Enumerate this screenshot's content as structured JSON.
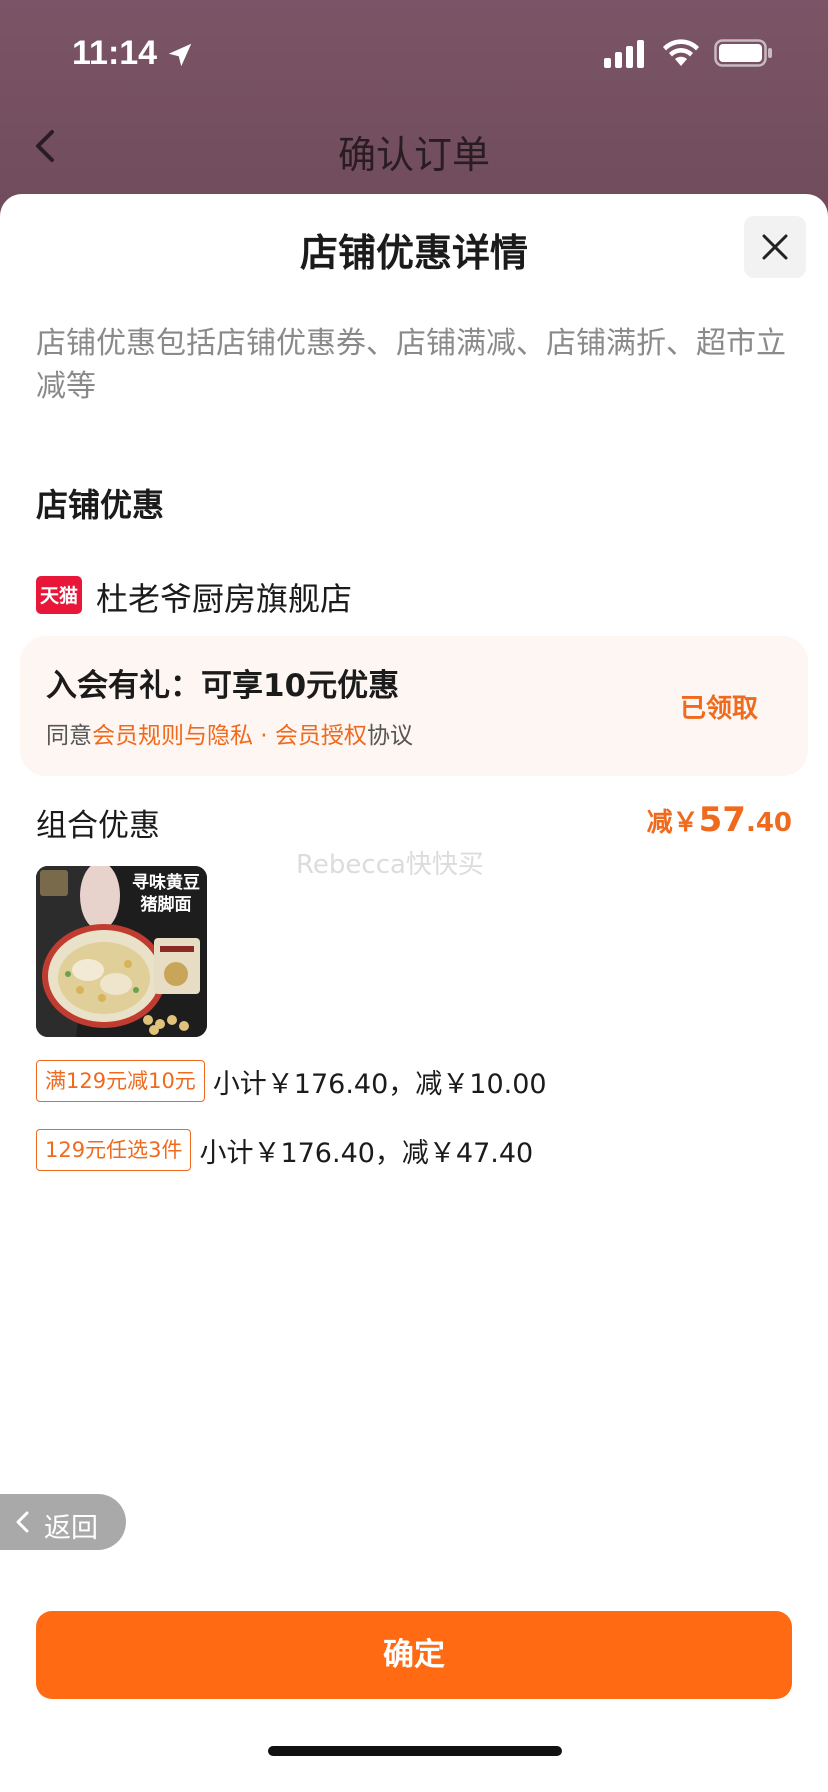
{
  "status_bar": {
    "time": "11:14"
  },
  "order_header": {
    "title": "确认订单"
  },
  "sheet": {
    "title": "店铺优惠详情",
    "description": "店铺优惠包括店铺优惠券、店铺满减、店铺满折、超市立减等",
    "section_title": "店铺优惠",
    "store": {
      "logo_text": "天猫",
      "name": "杜老爷厨房旗舰店"
    },
    "member_offer": {
      "title": "入会有礼：可享10元优惠",
      "agree_prefix": "同意",
      "agree_link": "会员规则与隐私 · 会员授权",
      "agree_suffix": "协议",
      "status": "已领取"
    },
    "combo": {
      "label": "组合优惠",
      "discount_prefix": "减￥",
      "discount_int": "57",
      "discount_dec": ".40"
    },
    "watermark": "Rebecca快快买",
    "product": {
      "title_line1": "寻味黄豆",
      "title_line2": "猪脚面"
    },
    "promotions": [
      {
        "tag": "满129元减10元",
        "text": "小计￥176.40，减￥10.00"
      },
      {
        "tag": "129元任选3件",
        "text": "小计￥176.40，减￥47.40"
      }
    ],
    "return_label": "返回",
    "confirm_label": "确定"
  },
  "colors": {
    "accent": "#ff6a13",
    "accent_text": "#f06a1d",
    "tmall_red": "#e8173a"
  }
}
